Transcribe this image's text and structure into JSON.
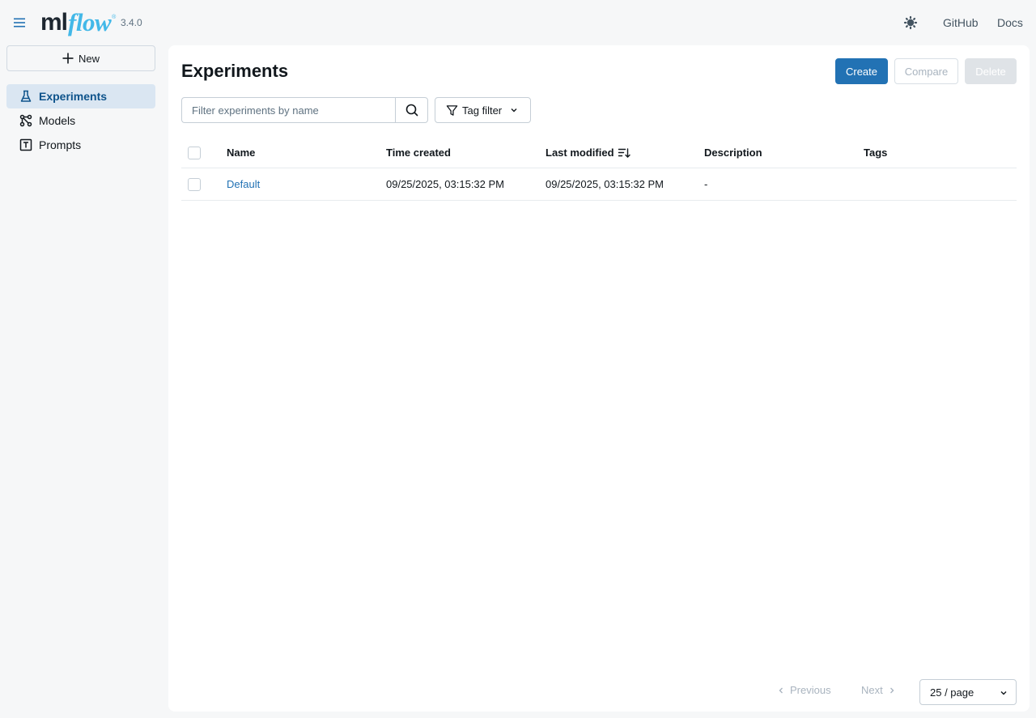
{
  "header": {
    "logo_ml": "ml",
    "logo_flow": "flow",
    "logo_tm": "®",
    "version": "3.4.0",
    "links": {
      "github": "GitHub",
      "docs": "Docs"
    },
    "icons": {
      "menu": "hamburger-menu-icon",
      "theme": "theme-toggle-icon"
    }
  },
  "sidebar": {
    "new_label": "New",
    "items": [
      {
        "label": "Experiments",
        "icon": "beaker-icon",
        "active": true
      },
      {
        "label": "Models",
        "icon": "models-icon",
        "active": false
      },
      {
        "label": "Prompts",
        "icon": "prompt-icon",
        "active": false
      }
    ]
  },
  "main": {
    "title": "Experiments",
    "buttons": {
      "create": "Create",
      "compare": "Compare",
      "delete": "Delete"
    },
    "search": {
      "placeholder": "Filter experiments by name",
      "value": ""
    },
    "tag_filter_label": "Tag filter",
    "table": {
      "headers": {
        "name": "Name",
        "created": "Time created",
        "modified": "Last modified",
        "description": "Description",
        "tags": "Tags"
      },
      "rows": [
        {
          "name": "Default",
          "created": "09/25/2025, 03:15:32 PM",
          "modified": "09/25/2025, 03:15:32 PM",
          "description": "-",
          "tags": ""
        }
      ]
    },
    "pagination": {
      "previous": "Previous",
      "next": "Next",
      "page_size": "25 / page"
    }
  },
  "colors": {
    "accent": "#2272b4",
    "active_nav_bg": "#dae6f2",
    "logo_flow": "#43b8e8",
    "background": "#f6f7f8"
  }
}
